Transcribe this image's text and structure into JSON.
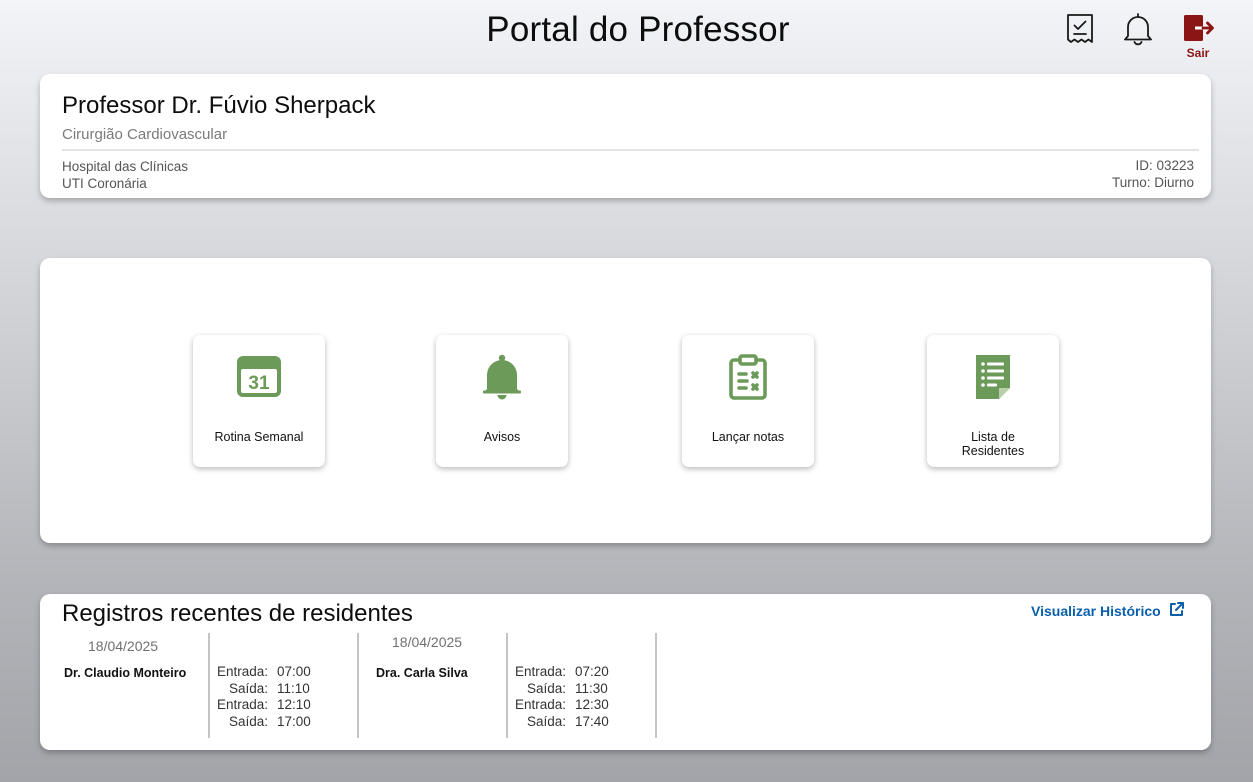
{
  "header": {
    "title": "Portal do Professor",
    "logout_label": "Sair",
    "icons": [
      "checklist-document-icon",
      "bell-icon",
      "logout-icon"
    ]
  },
  "profile": {
    "name": "Professor Dr. Fúvio Sherpack",
    "specialty": "Cirurgião Cardiovascular",
    "hospital": "Hospital das Clínicas",
    "unit": "UTI Coronária",
    "id": "ID: 03223",
    "shift": "Turno: Diurno"
  },
  "actions": [
    {
      "label": "Rotina Semanal",
      "icon": "calendar-icon",
      "icon_text": "31"
    },
    {
      "label": "Avisos",
      "icon": "bell-icon"
    },
    {
      "label": "Lançar notas",
      "icon": "clipboard-icon"
    },
    {
      "label": "Lista de Residentes",
      "icon": "list-document-icon"
    }
  ],
  "colors": {
    "accent_green": "#6c9a58",
    "logout_red": "#8b1414",
    "link_blue": "#0a5fab"
  },
  "records": {
    "title": "Registros recentes de residentes",
    "history_link": "Visualizar Histórico",
    "entries": [
      {
        "date": "18/04/2025",
        "name": "Dr. Claudio Monteiro",
        "times": [
          {
            "label": "Entrada:",
            "value": "07:00"
          },
          {
            "label": "Saída:",
            "value": "11:10"
          },
          {
            "label": "Entrada:",
            "value": "12:10"
          },
          {
            "label": "Saída:",
            "value": "17:00"
          }
        ]
      },
      {
        "date": "18/04/2025",
        "name": "Dra. Carla Silva",
        "times": [
          {
            "label": "Entrada:",
            "value": "07:20"
          },
          {
            "label": "Saída:",
            "value": "11:30"
          },
          {
            "label": "Entrada:",
            "value": "12:30"
          },
          {
            "label": "Saída:",
            "value": "17:40"
          }
        ]
      }
    ]
  }
}
